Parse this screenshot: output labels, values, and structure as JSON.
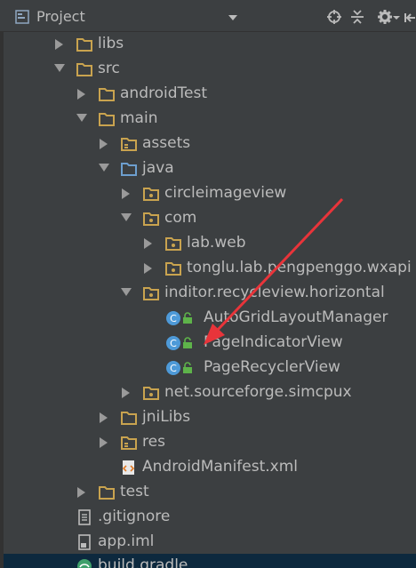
{
  "panel": {
    "title": "Project"
  },
  "tree": {
    "libs": "libs",
    "src": "src",
    "androidTest": "androidTest",
    "main": "main",
    "assets": "assets",
    "java": "java",
    "circleimageview": "circleimageview",
    "com": "com",
    "lab_web": "lab.web",
    "tonglu": "tonglu.lab.pengpenggo.wxapi",
    "inditor": "inditor.recycleview.horizontal",
    "autogrid": "AutoGridLayoutManager",
    "pageindicator": "PageIndicatorView",
    "pagerecycler": "PageRecyclerView",
    "simcpux": "net.sourceforge.simcpux",
    "jniLibs": "jniLibs",
    "res": "res",
    "manifest": "AndroidManifest.xml",
    "test": "test",
    "gitignore": ".gitignore",
    "appiml": "app.iml",
    "buildgradle": "build.gradle"
  },
  "colors": {
    "background": "#3c3f41",
    "text": "#bbbbbb",
    "folder": "#c9a34f",
    "source_folder": "#6d9fcf",
    "class_icon": "#4e9ad8",
    "annotation_arrow": "#e8343a",
    "selected_row": "#0d293e"
  },
  "icons": {
    "toolbar": [
      "project-view-icon",
      "locate-icon",
      "collapse-icon",
      "gear-icon",
      "hide-icon"
    ]
  }
}
